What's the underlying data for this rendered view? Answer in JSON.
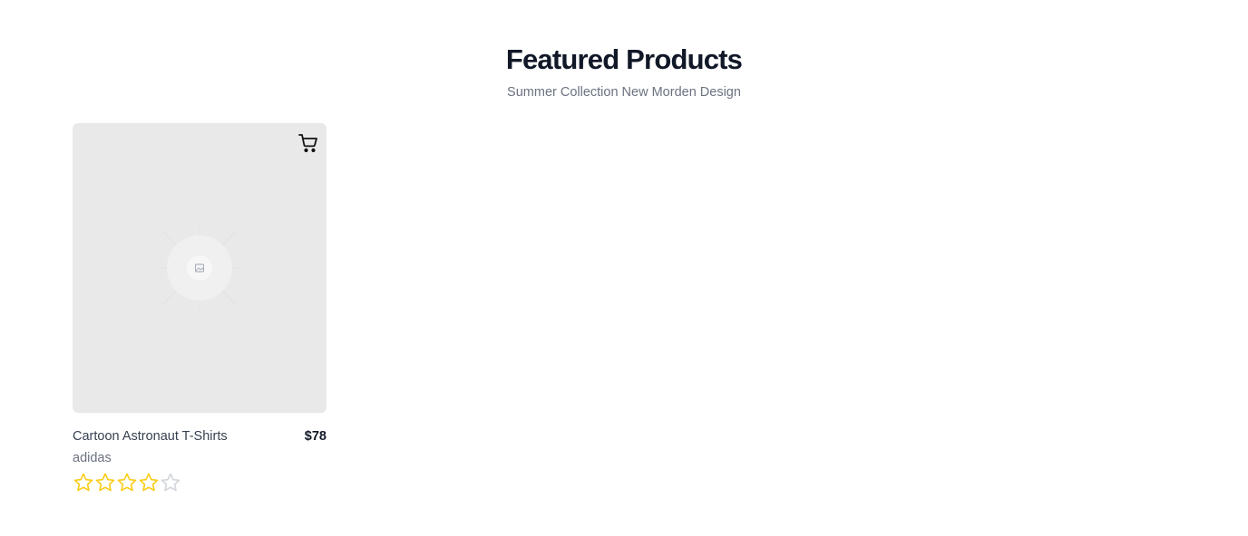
{
  "header": {
    "title": "Featured Products",
    "subtitle": "Summer Collection New Morden Design"
  },
  "products": [
    {
      "name": "Cartoon Astronaut T-Shirts",
      "brand": "adidas",
      "price": "$78",
      "rating": 4,
      "rating_max": 5,
      "image_icon": "image-placeholder-icon",
      "action_icon": "cart-icon"
    }
  ],
  "colors": {
    "star_filled": "#facc15",
    "star_empty": "#d1d5db",
    "card_bg": "#e9e9e9",
    "title": "#111827",
    "muted": "#6b7280"
  }
}
